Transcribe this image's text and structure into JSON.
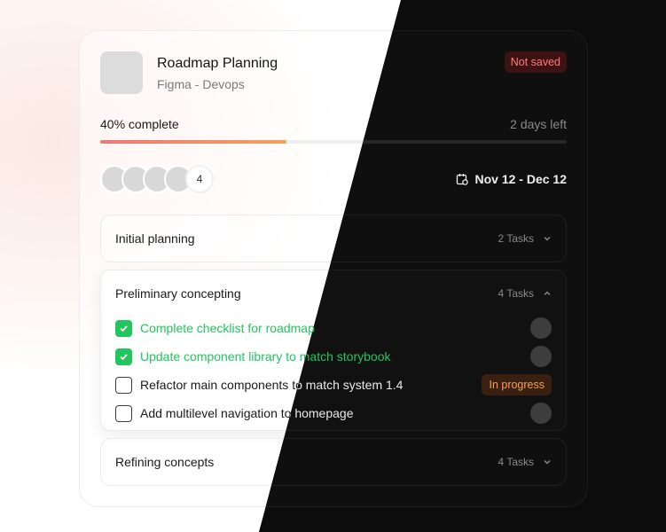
{
  "project": {
    "title": "Roadmap Planning",
    "subtitle": "Figma - Devops",
    "status_badge": "Not saved"
  },
  "progress": {
    "label": "40% complete",
    "value_percent": 40,
    "days_left": "2 days left"
  },
  "team": {
    "avatar_count": 4,
    "extra_count_label": "4"
  },
  "dates": {
    "range": "Nov 12 - Dec 12"
  },
  "sections": [
    {
      "name": "Initial planning",
      "tasks_label": "2 Tasks",
      "expanded": false,
      "chevron_icon": "chevron-down-icon"
    },
    {
      "name": "Preliminary concepting",
      "tasks_label": "4 Tasks",
      "expanded": true,
      "chevron_icon": "chevron-up-icon",
      "tasks": [
        {
          "text": "Complete checklist for roadmap",
          "checked": true,
          "trailing": "avatar"
        },
        {
          "text": "Update component library to match storybook",
          "checked": true,
          "trailing": "avatar"
        },
        {
          "text": "Refactor main components to match system 1.4",
          "checked": false,
          "trailing": "badge",
          "badge": "In progress"
        },
        {
          "text": "Add multilevel navigation to homepage",
          "checked": false,
          "trailing": "avatar"
        }
      ]
    },
    {
      "name": "Refining concepts",
      "tasks_label": "4 Tasks",
      "expanded": false,
      "chevron_icon": "chevron-down-icon"
    }
  ],
  "colors": {
    "success": "#22c55e",
    "progress_gradient_start": "#f07878",
    "progress_gradient_end": "#f3a05a",
    "warning": "#d97706",
    "danger": "#d23b3b"
  }
}
